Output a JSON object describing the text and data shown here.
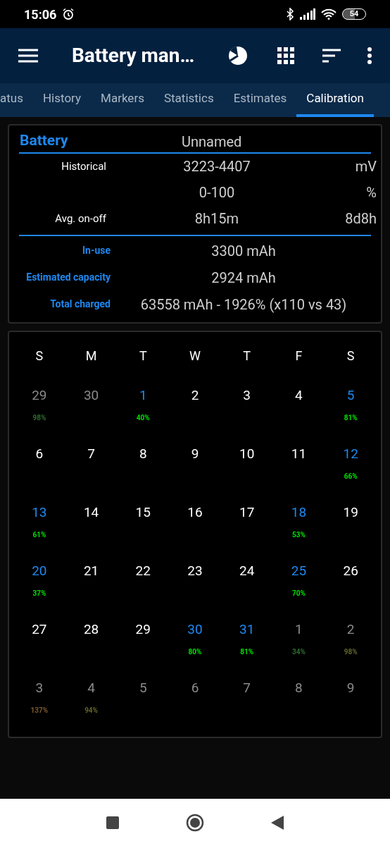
{
  "status_bar": {
    "time": "15:06",
    "battery": "54"
  },
  "app_bar": {
    "title": "Battery man…"
  },
  "tabs": [
    {
      "label": "atus",
      "selected": false
    },
    {
      "label": "History",
      "selected": false
    },
    {
      "label": "Markers",
      "selected": false
    },
    {
      "label": "Statistics",
      "selected": false
    },
    {
      "label": "Estimates",
      "selected": false
    },
    {
      "label": "Calibration",
      "selected": true
    }
  ],
  "battery_card": {
    "heading": "Battery",
    "name": "Unnamed",
    "rows": [
      {
        "label": "Historical",
        "value": "3223-4407",
        "unit": "mV"
      },
      {
        "value": "0-100",
        "unit": "%"
      },
      {
        "label": "Avg. on-off",
        "value": "8h15m",
        "unit": "8d8h"
      }
    ],
    "capacity_rows": [
      {
        "label": "In-use",
        "value": "3300 mAh"
      },
      {
        "label": "Estimated capacity",
        "value": "2924 mAh"
      },
      {
        "label": "Total charged",
        "value": "63558 mAh - 1926% (x110 vs 43)"
      }
    ]
  },
  "calendar": {
    "weekdays": [
      "S",
      "M",
      "T",
      "W",
      "T",
      "F",
      "S"
    ],
    "days": [
      {
        "day": "29",
        "kind": "outside",
        "percent": "98%",
        "color": "#2f6a2f"
      },
      {
        "day": "30",
        "kind": "outside"
      },
      {
        "day": "1",
        "kind": "marked",
        "percent": "40%",
        "color": "#00e000"
      },
      {
        "day": "2",
        "kind": "normal"
      },
      {
        "day": "3",
        "kind": "normal"
      },
      {
        "day": "4",
        "kind": "normal"
      },
      {
        "day": "5",
        "kind": "marked",
        "percent": "81%",
        "color": "#00e000"
      },
      {
        "day": "6",
        "kind": "normal"
      },
      {
        "day": "7",
        "kind": "normal"
      },
      {
        "day": "8",
        "kind": "normal"
      },
      {
        "day": "9",
        "kind": "normal"
      },
      {
        "day": "10",
        "kind": "normal"
      },
      {
        "day": "11",
        "kind": "normal"
      },
      {
        "day": "12",
        "kind": "marked",
        "percent": "66%",
        "color": "#00e000"
      },
      {
        "day": "13",
        "kind": "marked",
        "percent": "61%",
        "color": "#00e000"
      },
      {
        "day": "14",
        "kind": "normal"
      },
      {
        "day": "15",
        "kind": "normal"
      },
      {
        "day": "16",
        "kind": "normal"
      },
      {
        "day": "17",
        "kind": "normal"
      },
      {
        "day": "18",
        "kind": "marked",
        "percent": "53%",
        "color": "#00e000"
      },
      {
        "day": "19",
        "kind": "normal"
      },
      {
        "day": "20",
        "kind": "marked",
        "percent": "37%",
        "color": "#00e000"
      },
      {
        "day": "21",
        "kind": "normal"
      },
      {
        "day": "22",
        "kind": "normal"
      },
      {
        "day": "23",
        "kind": "normal"
      },
      {
        "day": "24",
        "kind": "normal"
      },
      {
        "day": "25",
        "kind": "marked",
        "percent": "70%",
        "color": "#00e000"
      },
      {
        "day": "26",
        "kind": "normal"
      },
      {
        "day": "27",
        "kind": "normal"
      },
      {
        "day": "28",
        "kind": "normal"
      },
      {
        "day": "29",
        "kind": "normal"
      },
      {
        "day": "30",
        "kind": "marked",
        "percent": "80%",
        "color": "#00e000"
      },
      {
        "day": "31",
        "kind": "marked",
        "percent": "81%",
        "color": "#00e000"
      },
      {
        "day": "1",
        "kind": "outside",
        "percent": "34%",
        "color": "#2f6a2f"
      },
      {
        "day": "2",
        "kind": "outside",
        "percent": "98%",
        "color": "#62622a"
      },
      {
        "day": "3",
        "kind": "outside",
        "percent": "137%",
        "color": "#7a5a2a"
      },
      {
        "day": "4",
        "kind": "outside",
        "percent": "94%",
        "color": "#64642a"
      },
      {
        "day": "5",
        "kind": "outside"
      },
      {
        "day": "6",
        "kind": "outside"
      },
      {
        "day": "7",
        "kind": "outside"
      },
      {
        "day": "8",
        "kind": "outside"
      },
      {
        "day": "9",
        "kind": "outside"
      }
    ]
  }
}
